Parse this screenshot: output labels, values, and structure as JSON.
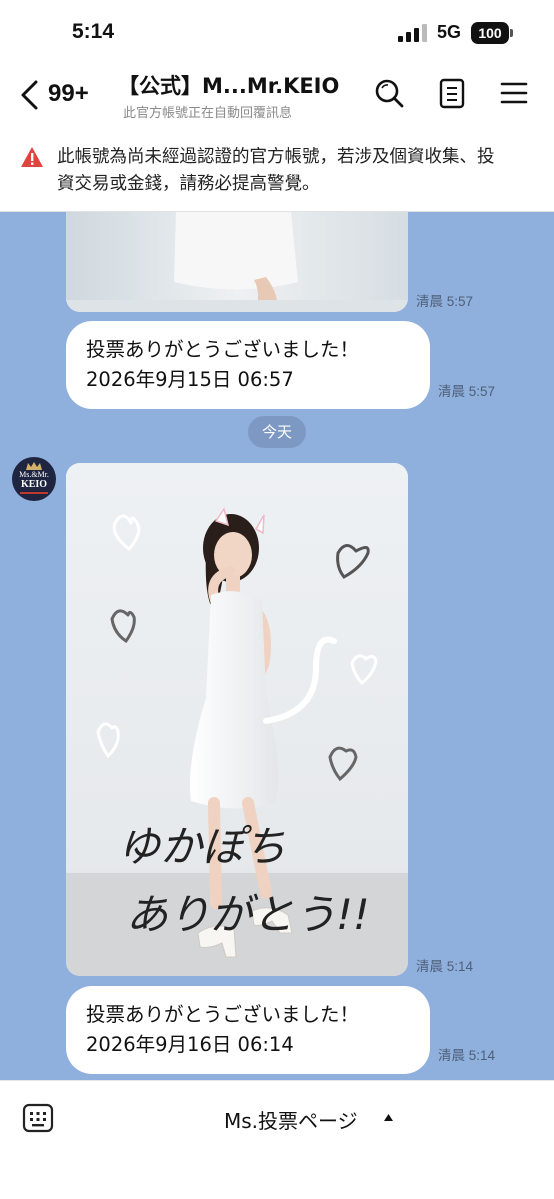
{
  "status_bar": {
    "time": "5:14",
    "network": "5G",
    "battery": "100"
  },
  "header": {
    "back_count": "99+",
    "title": "【公式】M...Mr.KEIO",
    "subtitle": "此官方帳號正在自動回覆訊息"
  },
  "warning": {
    "text": "此帳號為尚未經過認證的官方帳號，若涉及個資收集、投資交易或金錢，請務必提高警覺。"
  },
  "messages": [
    {
      "type": "image",
      "time": "清晨 5:57"
    },
    {
      "type": "text",
      "line1": "投票ありがとうございました！",
      "line2": "2026年9月15日 06:57",
      "time": "清晨 5:57"
    },
    {
      "type": "date",
      "label": "今天"
    },
    {
      "type": "image",
      "time": "清晨 5:14",
      "caption_line1": "ゆかぽち",
      "caption_line2": "ありがとう!!"
    },
    {
      "type": "text",
      "line1": "投票ありがとうございました！",
      "line2": "2026年9月16日 06:14",
      "time": "清晨 5:14"
    }
  ],
  "avatar": {
    "line1": "Ms.&Mr.",
    "line2": "KEIO"
  },
  "bottom_bar": {
    "menu_label": "Ms.投票ページ"
  },
  "icons": [
    "back-icon",
    "search-icon",
    "notes-icon",
    "menu-icon",
    "warning-icon",
    "close-icon",
    "keyboard-icon",
    "caret-up-icon"
  ],
  "colors": {
    "chat_background": "#8fb0dd",
    "date_pill": "#7c98c3",
    "warning_red": "#e0443e"
  }
}
